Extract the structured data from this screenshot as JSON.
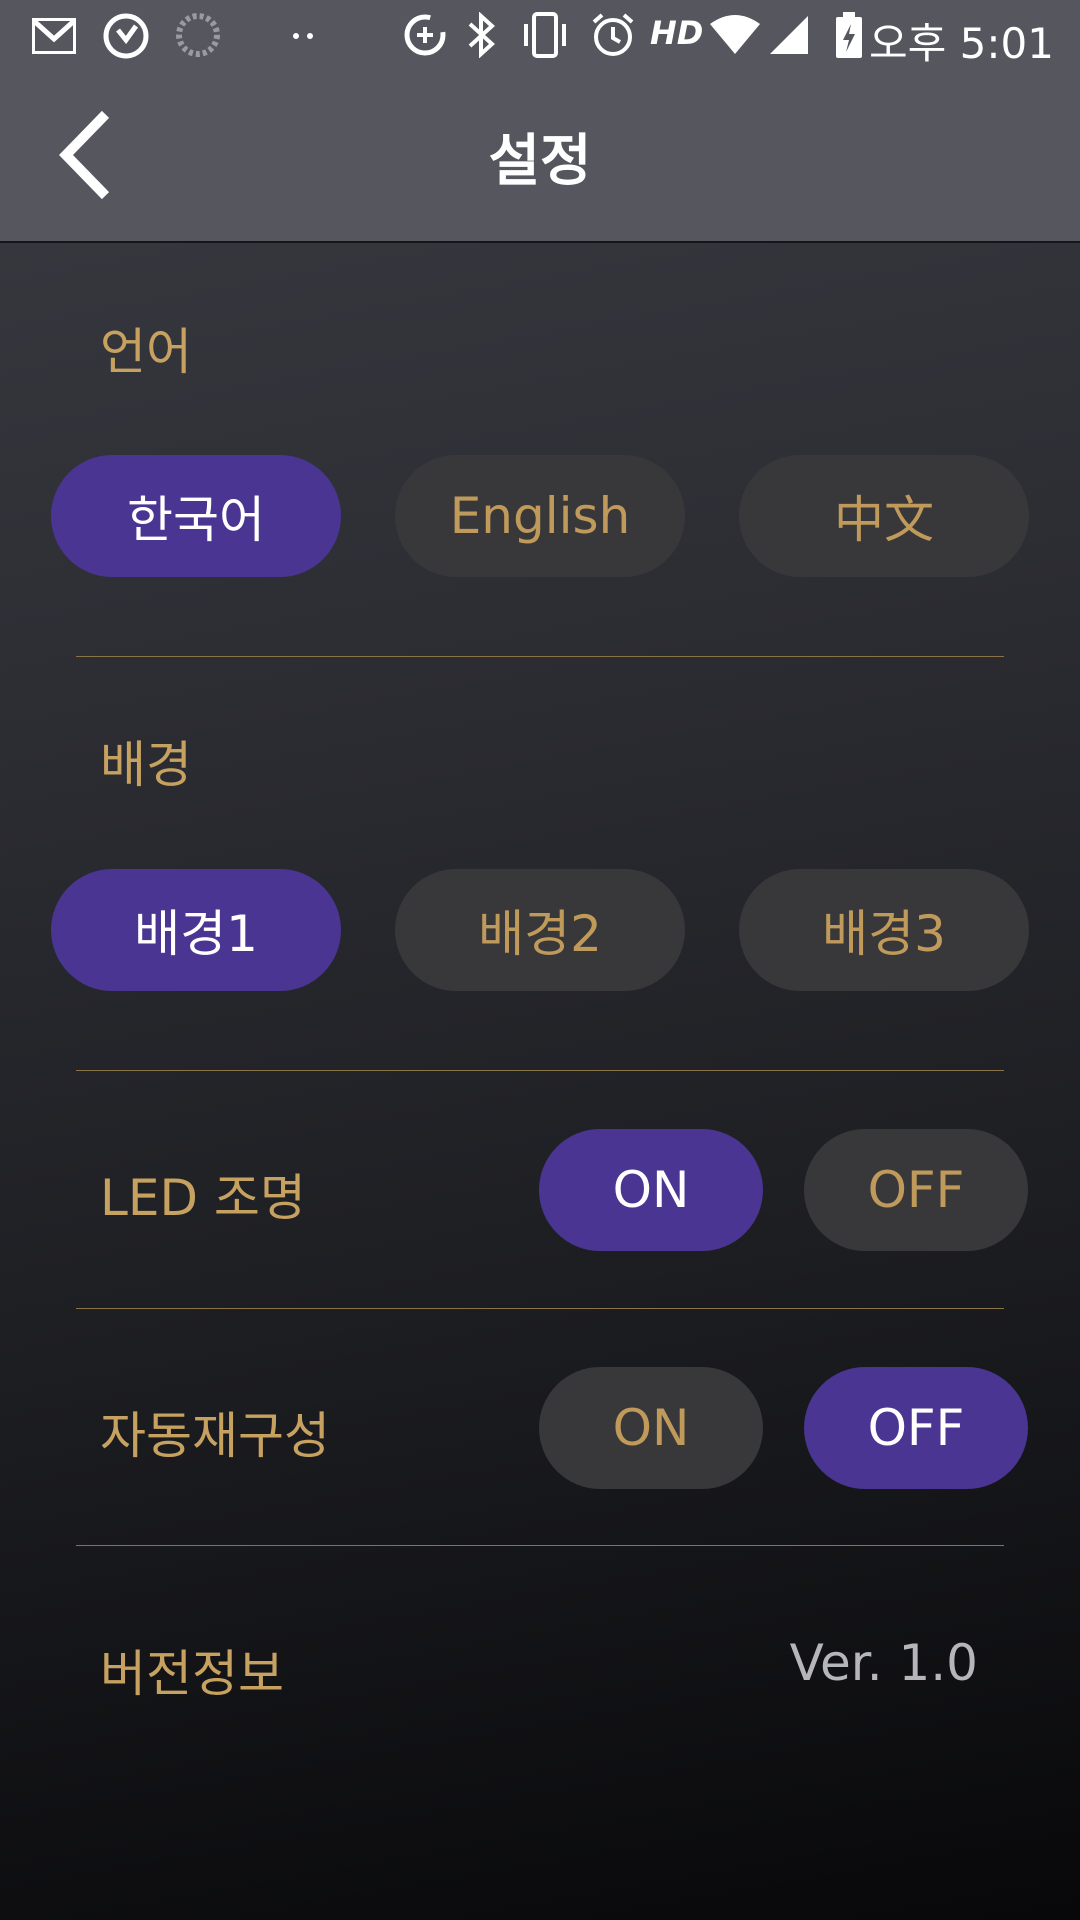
{
  "status_bar": {
    "time": "오후 5:01",
    "hd_label": "HD",
    "icons": [
      "gmail-icon",
      "clock-app-icon",
      "loading-icon",
      "more-dots-icon",
      "data-saver-icon",
      "bluetooth-icon",
      "vibrate-icon",
      "alarm-icon",
      "hd-icon",
      "wifi-icon",
      "signal-icon",
      "battery-charging-icon"
    ]
  },
  "header": {
    "title": "설정",
    "back_icon": "chevron-left-icon"
  },
  "language": {
    "label": "언어",
    "options": [
      "한국어",
      "English",
      "中文"
    ],
    "selected": "한국어"
  },
  "background": {
    "label": "배경",
    "options": [
      "배경1",
      "배경2",
      "배경3"
    ],
    "selected": "배경1"
  },
  "led": {
    "label": "LED 조명",
    "on_label": "ON",
    "off_label": "OFF",
    "selected": "ON"
  },
  "auto_reconfig": {
    "label": "자동재구성",
    "on_label": "ON",
    "off_label": "OFF",
    "selected": "OFF"
  },
  "version_info": {
    "label": "버전정보",
    "value": "Ver. 1.0"
  },
  "colors": {
    "accent": "#4a3592",
    "gold": "#c6a15f",
    "bar": "#55565e",
    "inactive_pill": "#38383b"
  }
}
